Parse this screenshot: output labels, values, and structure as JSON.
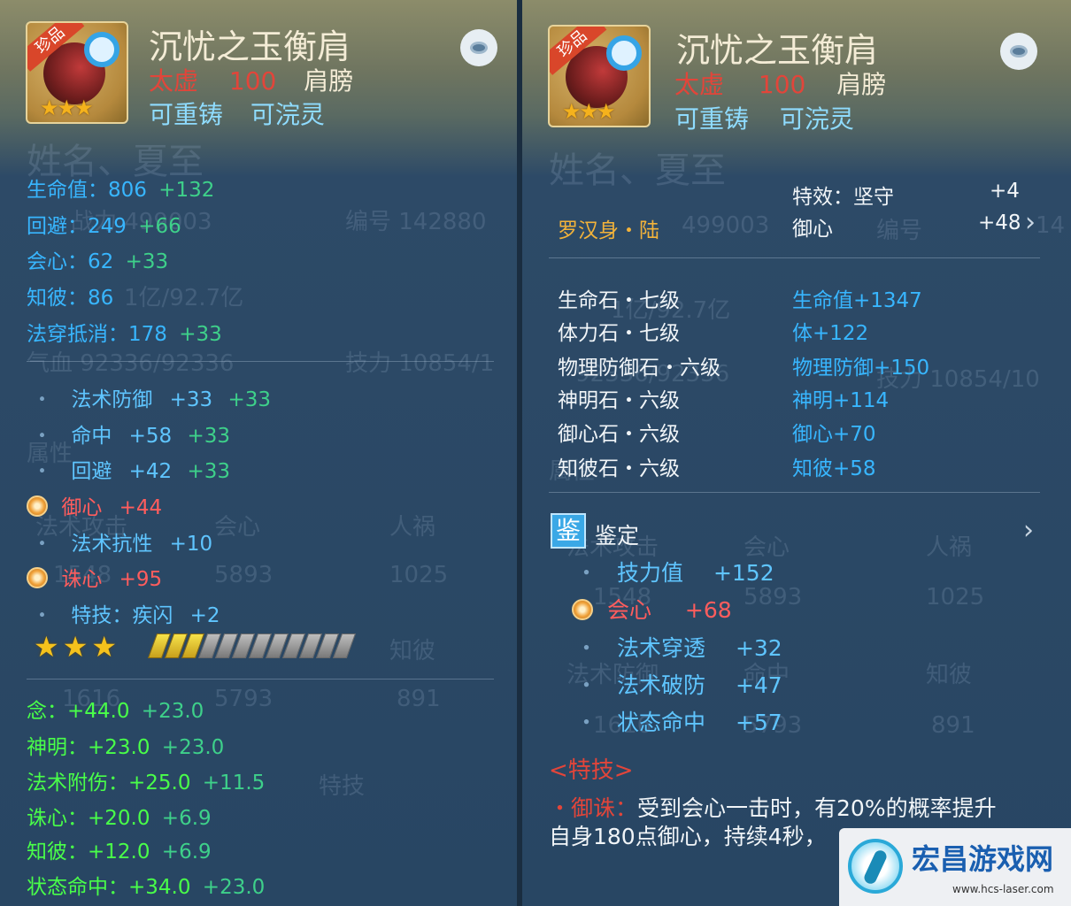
{
  "common": {
    "item_name": "沉忧之玉衡肩",
    "realm": "太虚",
    "level": "100",
    "slot": "肩膀",
    "recast": "可重铸",
    "refine": "可浣灵",
    "badge": "珍品",
    "icon_stars": "★★★"
  },
  "left": {
    "ghost_texts": [
      "姓名、夏至",
      "战力 499003",
      "编号 142880",
      "1亿/92.7亿",
      "气血 92336/92336",
      "技力 10854/1",
      "属性",
      "法术攻击",
      "会心",
      "人祸",
      "1548",
      "5893",
      "1025",
      "知彼",
      "1616",
      "5793",
      "891",
      "特技"
    ],
    "base_stats": [
      {
        "label": "生命值：806",
        "bonus": "+132"
      },
      {
        "label": "回避：249",
        "bonus": "+66"
      },
      {
        "label": "会心：62",
        "bonus": "+33"
      },
      {
        "label": "知彼：86",
        "bonus": ""
      },
      {
        "label": "法穿抵消：178",
        "bonus": "+33"
      }
    ],
    "extra_stats": [
      {
        "type": "dot",
        "label": "法术防御",
        "v1": "+33",
        "v2": "+33"
      },
      {
        "type": "dot",
        "label": "命中",
        "v1": "+58",
        "v2": "+33"
      },
      {
        "type": "dot",
        "label": "回避",
        "v1": "+42",
        "v2": "+33"
      },
      {
        "type": "gem",
        "label": "御心",
        "v1": "+44",
        "v2": ""
      },
      {
        "type": "dot",
        "label": "法术抗性",
        "v1": "+10",
        "v2": ""
      },
      {
        "type": "gem",
        "label": "诛心",
        "v1": "+95",
        "v2": ""
      },
      {
        "type": "dot",
        "label": "特技：疾闪",
        "v1": "+2",
        "v2": ""
      }
    ],
    "star_rating": "★★★",
    "enhance_level": 0.25,
    "nian_stats": [
      {
        "label": "念：+44.0",
        "extra": "+23.0"
      },
      {
        "label": "神明：+23.0",
        "extra": "+23.0"
      },
      {
        "label": "法术附伤：+25.0",
        "extra": "+11.5"
      },
      {
        "label": "诛心：+20.0",
        "extra": "+6.9"
      },
      {
        "label": "知彼：+12.0",
        "extra": "+6.9"
      },
      {
        "label": "状态命中：+34.0",
        "extra": "+23.0"
      }
    ]
  },
  "right": {
    "ghost_texts": [
      "姓名、夏至",
      "499003",
      "编号",
      "14",
      "1亿/92.7亿",
      "92336/92336",
      "技力 10854/10",
      "属性",
      "法术攻击",
      "会心",
      "人祸",
      "1548",
      "5893",
      "1025",
      "法术防御",
      "命中",
      "知彼",
      "1616",
      "5793",
      "891"
    ],
    "effect_label": "特效：坚守",
    "effect_value": "+4",
    "yuxin_label": "御心",
    "yuxin_value": "+48",
    "set_name": "罗汉身・陆",
    "gems": [
      {
        "name": "生命石・七级",
        "effect": "生命值+1347"
      },
      {
        "name": "体力石・七级",
        "effect": "体+122"
      },
      {
        "name": "物理防御石・六级",
        "effect": "物理防御+150"
      },
      {
        "name": "神明石・六级",
        "effect": "神明+114"
      },
      {
        "name": "御心石・六级",
        "effect": "御心+70"
      },
      {
        "name": "知彼石・六级",
        "effect": "知彼+58"
      }
    ],
    "appraisal_icon": "鉴",
    "appraisal_title": "鉴定",
    "appraisal_stats": [
      {
        "type": "dot",
        "label": "技力值",
        "value": "+152"
      },
      {
        "type": "gem",
        "label": "会心",
        "value": "+68"
      },
      {
        "type": "dot",
        "label": "法术穿透",
        "value": "+32"
      },
      {
        "type": "dot",
        "label": "法术破防",
        "value": "+47"
      },
      {
        "type": "dot",
        "label": "状态命中",
        "value": "+57"
      }
    ],
    "skill_header": "<特技>",
    "skill_name": "・御诛：",
    "skill_desc_1": "受到会心一击时，有20%的概率提升",
    "skill_desc_2": "自身180点御心，持续4秒，"
  },
  "watermark": {
    "title": "宏昌游戏网",
    "url": "www.hcs-laser.com"
  }
}
